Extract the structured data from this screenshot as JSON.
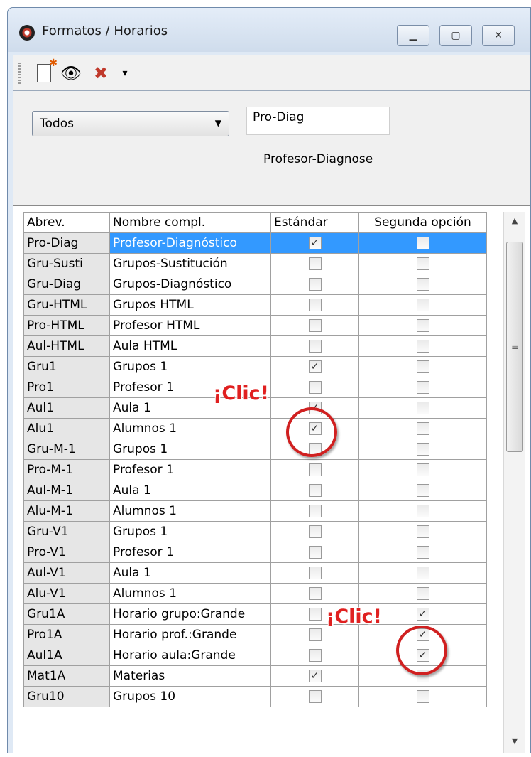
{
  "window": {
    "title": "Formatos / Horarios"
  },
  "toolbar": {
    "new_icon": "new-document-icon",
    "view_icon": "eye-icon",
    "delete_icon": "delete-x-icon",
    "drop_icon": "dropdown-arrow-icon"
  },
  "panel": {
    "filter_value": "Todos",
    "abrev_value": "Pro-Diag",
    "description": "Profesor-Diagnose"
  },
  "table": {
    "headers": [
      "Abrev.",
      "Nombre compl.",
      "Estándar",
      "Segunda opción"
    ],
    "rows": [
      {
        "abrev": "Pro-Diag",
        "nombre": "Profesor-Diagnóstico",
        "est": true,
        "seg": false,
        "selected": true
      },
      {
        "abrev": "Gru-Susti",
        "nombre": "Grupos-Sustitución",
        "est": false,
        "seg": false
      },
      {
        "abrev": "Gru-Diag",
        "nombre": "Grupos-Diagnóstico",
        "est": false,
        "seg": false
      },
      {
        "abrev": "Gru-HTML",
        "nombre": "Grupos HTML",
        "est": false,
        "seg": false
      },
      {
        "abrev": "Pro-HTML",
        "nombre": "Profesor HTML",
        "est": false,
        "seg": false
      },
      {
        "abrev": "Aul-HTML",
        "nombre": "Aula HTML",
        "est": false,
        "seg": false
      },
      {
        "abrev": "Gru1",
        "nombre": "Grupos 1",
        "est": true,
        "seg": false
      },
      {
        "abrev": "Pro1",
        "nombre": "Profesor 1",
        "est": false,
        "seg": false
      },
      {
        "abrev": "Aul1",
        "nombre": "Aula 1",
        "est": true,
        "seg": false
      },
      {
        "abrev": "Alu1",
        "nombre": "Alumnos 1",
        "est": true,
        "seg": false
      },
      {
        "abrev": "Gru-M-1",
        "nombre": "Grupos 1",
        "est": false,
        "seg": false
      },
      {
        "abrev": "Pro-M-1",
        "nombre": "Profesor 1",
        "est": false,
        "seg": false
      },
      {
        "abrev": "Aul-M-1",
        "nombre": "Aula 1",
        "est": false,
        "seg": false
      },
      {
        "abrev": "Alu-M-1",
        "nombre": "Alumnos 1",
        "est": false,
        "seg": false
      },
      {
        "abrev": "Gru-V1",
        "nombre": "Grupos 1",
        "est": false,
        "seg": false
      },
      {
        "abrev": "Pro-V1",
        "nombre": "Profesor 1",
        "est": false,
        "seg": false
      },
      {
        "abrev": "Aul-V1",
        "nombre": "Aula 1",
        "est": false,
        "seg": false
      },
      {
        "abrev": "Alu-V1",
        "nombre": "Alumnos 1",
        "est": false,
        "seg": false
      },
      {
        "abrev": "Gru1A",
        "nombre": "Horario grupo:Grande",
        "est": false,
        "seg": true
      },
      {
        "abrev": "Pro1A",
        "nombre": "Horario prof.:Grande",
        "est": false,
        "seg": true
      },
      {
        "abrev": "Aul1A",
        "nombre": "Horario aula:Grande",
        "est": false,
        "seg": true
      },
      {
        "abrev": "Mat1A",
        "nombre": "Materias",
        "est": true,
        "seg": false
      },
      {
        "abrev": "Gru10",
        "nombre": "Grupos 10",
        "est": false,
        "seg": false
      }
    ]
  },
  "annotations": {
    "click_label_1": "¡Clic!",
    "click_label_2": "¡Clic!"
  },
  "colors": {
    "selection": "#3399ff",
    "annotation": "#d02020"
  }
}
